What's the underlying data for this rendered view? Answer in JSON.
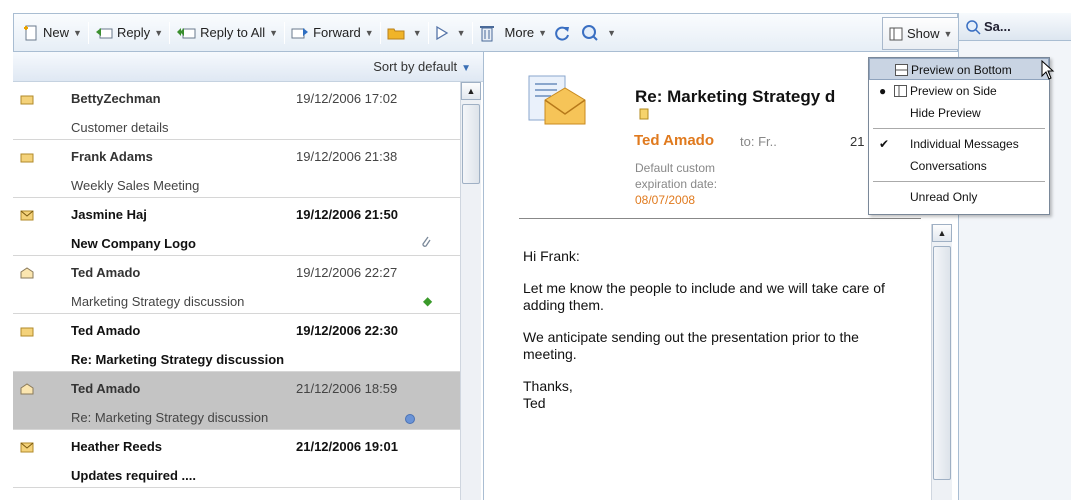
{
  "toolbar": {
    "new": "New",
    "reply": "Reply",
    "reply_all": "Reply to All",
    "forward": "Forward",
    "more": "More",
    "show": "Show"
  },
  "right_panel": {
    "title": "Sa..."
  },
  "sort": {
    "label": "Sort by default"
  },
  "messages": [
    {
      "from": "BettyZechman",
      "date": "19/12/2006 17:02",
      "subject": "Customer details"
    },
    {
      "from": "Frank Adams",
      "date": "19/12/2006 21:38",
      "subject": "Weekly Sales Meeting"
    },
    {
      "from": "Jasmine Haj",
      "date": "19/12/2006 21:50",
      "subject": "New Company Logo"
    },
    {
      "from": "Ted Amado",
      "date": "19/12/2006 22:27",
      "subject": "Marketing Strategy discussion"
    },
    {
      "from": "Ted Amado",
      "date": "19/12/2006 22:30",
      "subject": "Re: Marketing Strategy discussion"
    },
    {
      "from": "Ted Amado",
      "date": "21/12/2006 18:59",
      "subject": "Re: Marketing Strategy discussion"
    },
    {
      "from": "Heather Reeds",
      "date": "21/12/2006 19:01",
      "subject": "Updates required ...."
    }
  ],
  "preview": {
    "title": "Re: Marketing Strategy d",
    "sender": "Ted Amado",
    "to": "to: Fr..",
    "date": "21",
    "meta1": "Default custom",
    "meta2": "expiration date:",
    "expiry": "08/07/2008",
    "body": [
      "Hi Frank:",
      "Let me know the people to include and we will take care of adding them.",
      "We anticipate sending out the presentation prior to the meeting.",
      "Thanks,",
      "Ted"
    ]
  },
  "menu": {
    "items": [
      "Preview on Bottom",
      "Preview on Side",
      "Hide Preview",
      "Individual Messages",
      "Conversations",
      "Unread Only"
    ]
  }
}
